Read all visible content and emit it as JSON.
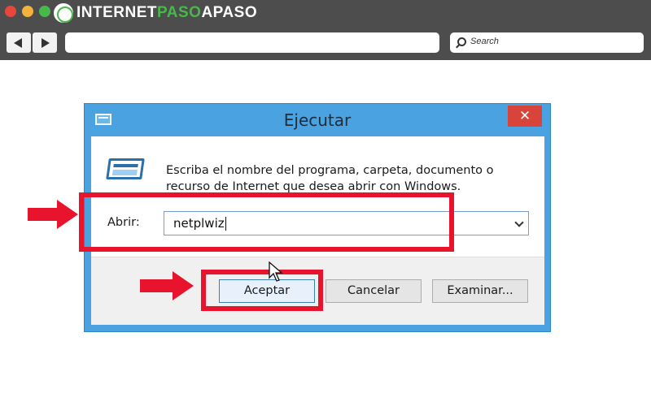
{
  "browser": {
    "brand_part1": "INTERNET",
    "brand_part2": "PASO",
    "brand_part3": "APASO",
    "search_placeholder": "Search"
  },
  "dialog": {
    "title": "Ejecutar",
    "close_glyph": "✕",
    "description": "Escriba el nombre del programa, carpeta, documento o recurso de Internet que desea abrir con Windows.",
    "open_label": "Abrir:",
    "open_value": "netplwiz",
    "buttons": {
      "ok": "Aceptar",
      "cancel": "Cancelar",
      "browse": "Examinar..."
    }
  },
  "colors": {
    "highlight": "#e8132c",
    "titlebar": "#4aa3e0",
    "close": "#d9443a",
    "chrome": "#4d4d4d"
  }
}
